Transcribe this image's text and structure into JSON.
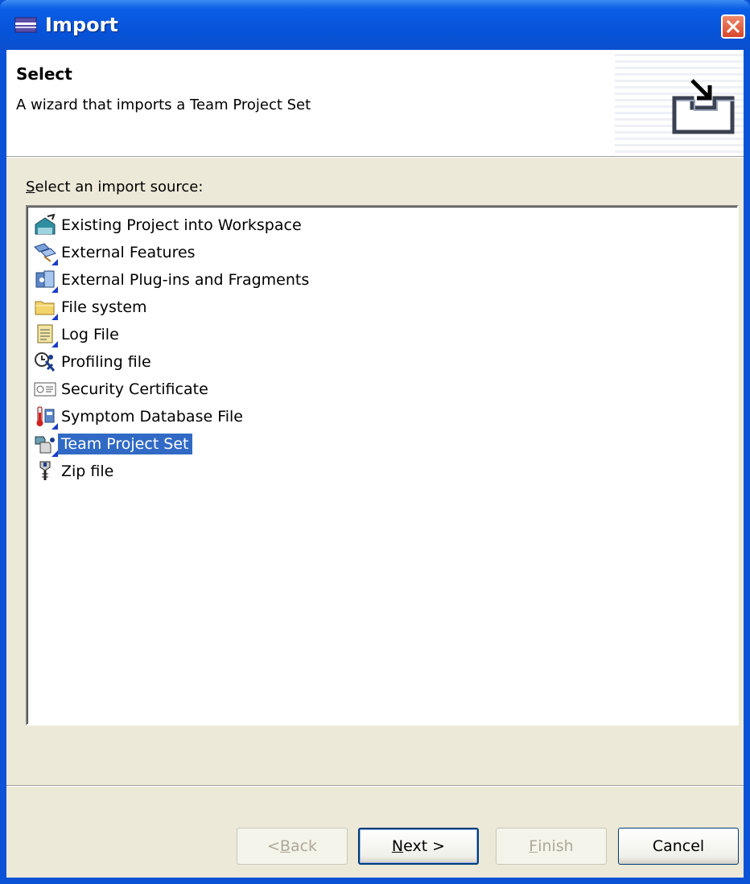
{
  "window": {
    "title": "Import"
  },
  "header": {
    "title": "Select",
    "description": "A wizard that imports a Team Project Set"
  },
  "source_label": {
    "mnemonic": "S",
    "rest": "elect an import source:"
  },
  "tree": {
    "items": [
      {
        "label": "Existing Project into Workspace",
        "icon": "project-icon",
        "selected": false
      },
      {
        "label": "External Features",
        "icon": "features-icon",
        "selected": false
      },
      {
        "label": "External Plug-ins and Fragments",
        "icon": "plugin-icon",
        "selected": false
      },
      {
        "label": "File system",
        "icon": "folder-icon",
        "selected": false
      },
      {
        "label": "Log File",
        "icon": "log-file-icon",
        "selected": false
      },
      {
        "label": "Profiling file",
        "icon": "profiling-icon",
        "selected": false
      },
      {
        "label": "Security Certificate",
        "icon": "certificate-icon",
        "selected": false
      },
      {
        "label": "Symptom Database File",
        "icon": "symptom-db-icon",
        "selected": false
      },
      {
        "label": "Team Project Set",
        "icon": "team-project-icon",
        "selected": true
      },
      {
        "label": "Zip file",
        "icon": "zip-icon",
        "selected": false
      }
    ]
  },
  "buttons": {
    "back": {
      "pre": "< ",
      "mnemonic": "B",
      "rest": "ack",
      "enabled": false
    },
    "next": {
      "mnemonic": "N",
      "rest": "ext >",
      "enabled": true
    },
    "finish": {
      "mnemonic": "F",
      "rest": "inish",
      "enabled": false
    },
    "cancel": {
      "label": "Cancel",
      "enabled": true
    }
  },
  "colors": {
    "selection": "#316ac5",
    "titlebar": "#0a5ee6",
    "dialog_bg": "#ece9d8"
  }
}
